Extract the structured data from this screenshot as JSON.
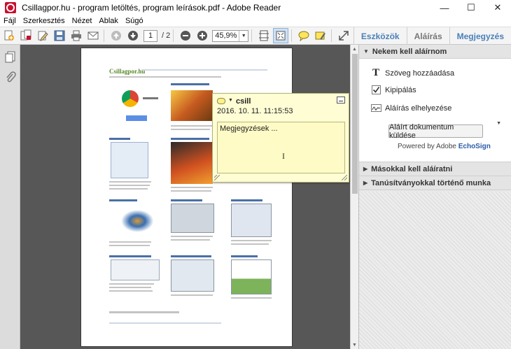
{
  "window": {
    "title": "Csillagpor.hu - program letöltés, program leírások.pdf - Adobe Reader",
    "minimize": "—",
    "maximize": "☐",
    "close": "✕"
  },
  "menu": [
    "Fájl",
    "Szerkesztés",
    "Nézet",
    "Ablak",
    "Súgó"
  ],
  "toolbar": {
    "page_current": "1",
    "page_total": "/ 2",
    "zoom": "45,9%",
    "tabs": [
      {
        "label": "Eszközök",
        "active": true
      },
      {
        "label": "Aláírás",
        "active": false
      },
      {
        "label": "Megjegyzés",
        "active": true
      }
    ]
  },
  "note": {
    "author": "csill",
    "date": "2016. 10. 11. 11:15:53",
    "body": "Megjegyzések ..."
  },
  "right_panel": {
    "section1": {
      "title": "Nekem kell aláírnom",
      "items": [
        "Szöveg hozzáadása",
        "Kipipálás",
        "Aláírás elhelyezése"
      ],
      "send_button": "Aláírt dokumentum küldése",
      "powered_prefix": "Powered by Adobe",
      "powered_brand": "EchoSign"
    },
    "section2": {
      "title": "Másokkal kell aláíratni"
    },
    "section3": {
      "title": "Tanúsítványokkal történő munka"
    }
  },
  "page_preview": {
    "logo": "Csillagpor.hu"
  },
  "colors": {
    "accent": "#4a7fb8",
    "note_bg": "#fefdd4",
    "doc_bg": "#575757"
  }
}
